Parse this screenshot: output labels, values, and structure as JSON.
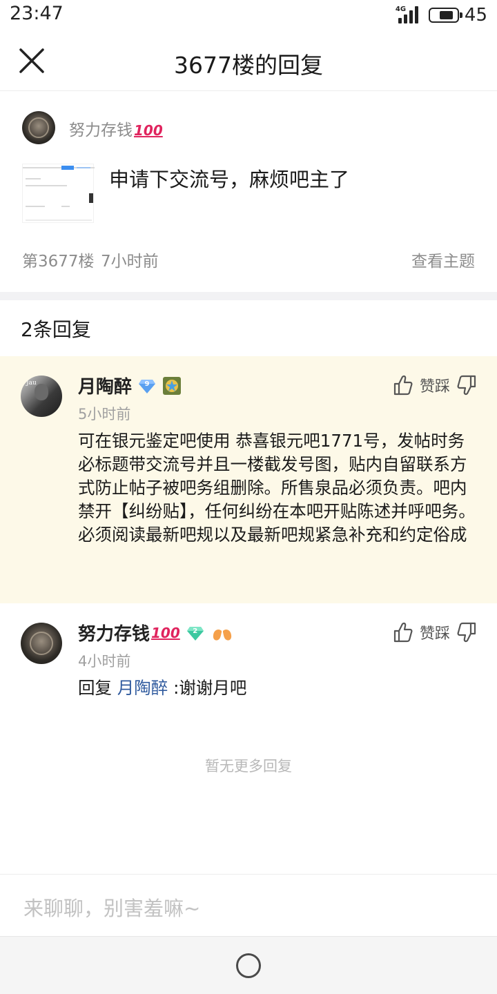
{
  "status_bar": {
    "time": "23:47",
    "network": "4G",
    "battery": "45"
  },
  "header": {
    "title": "3677楼的回复"
  },
  "post": {
    "author": "努力存钱",
    "author_emoji": "100",
    "text": "申请下交流号，麻烦吧主了",
    "floor": "第3677楼",
    "time": "7小时前",
    "view_topic": "查看主题"
  },
  "reply_count": "2条回复",
  "replies": [
    {
      "name": "月陶醉",
      "level": "9",
      "time": "5小时前",
      "body": "可在银元鉴定吧使用 恭喜银元吧1771号，发帖时务必标题带交流号并且一楼截发号图，贴内自留联系方式防止帖子被吧务组删除。所售泉品必须负责。吧内禁开【纠纷贴】，任何纠纷在本吧开贴陈述并呼吧务。必须阅读最新吧规以及最新吧规紧急补充和约定俗成",
      "vote_label": "赞踩"
    },
    {
      "name": "努力存钱",
      "name_emoji": "100",
      "level": "2",
      "time": "4小时前",
      "reply_prefix": "回复",
      "mention": "月陶醉",
      "body": ":谢谢月吧",
      "vote_label": "赞踩"
    }
  ],
  "no_more": "暂无更多回复",
  "input": {
    "placeholder": "来聊聊，别害羞嘛~"
  },
  "colors": {
    "highlight_bg": "#fdf9e8",
    "mention": "#2f5a9e",
    "level9_badge": "#5aa0f0",
    "level2_badge": "#3cc8a0"
  }
}
